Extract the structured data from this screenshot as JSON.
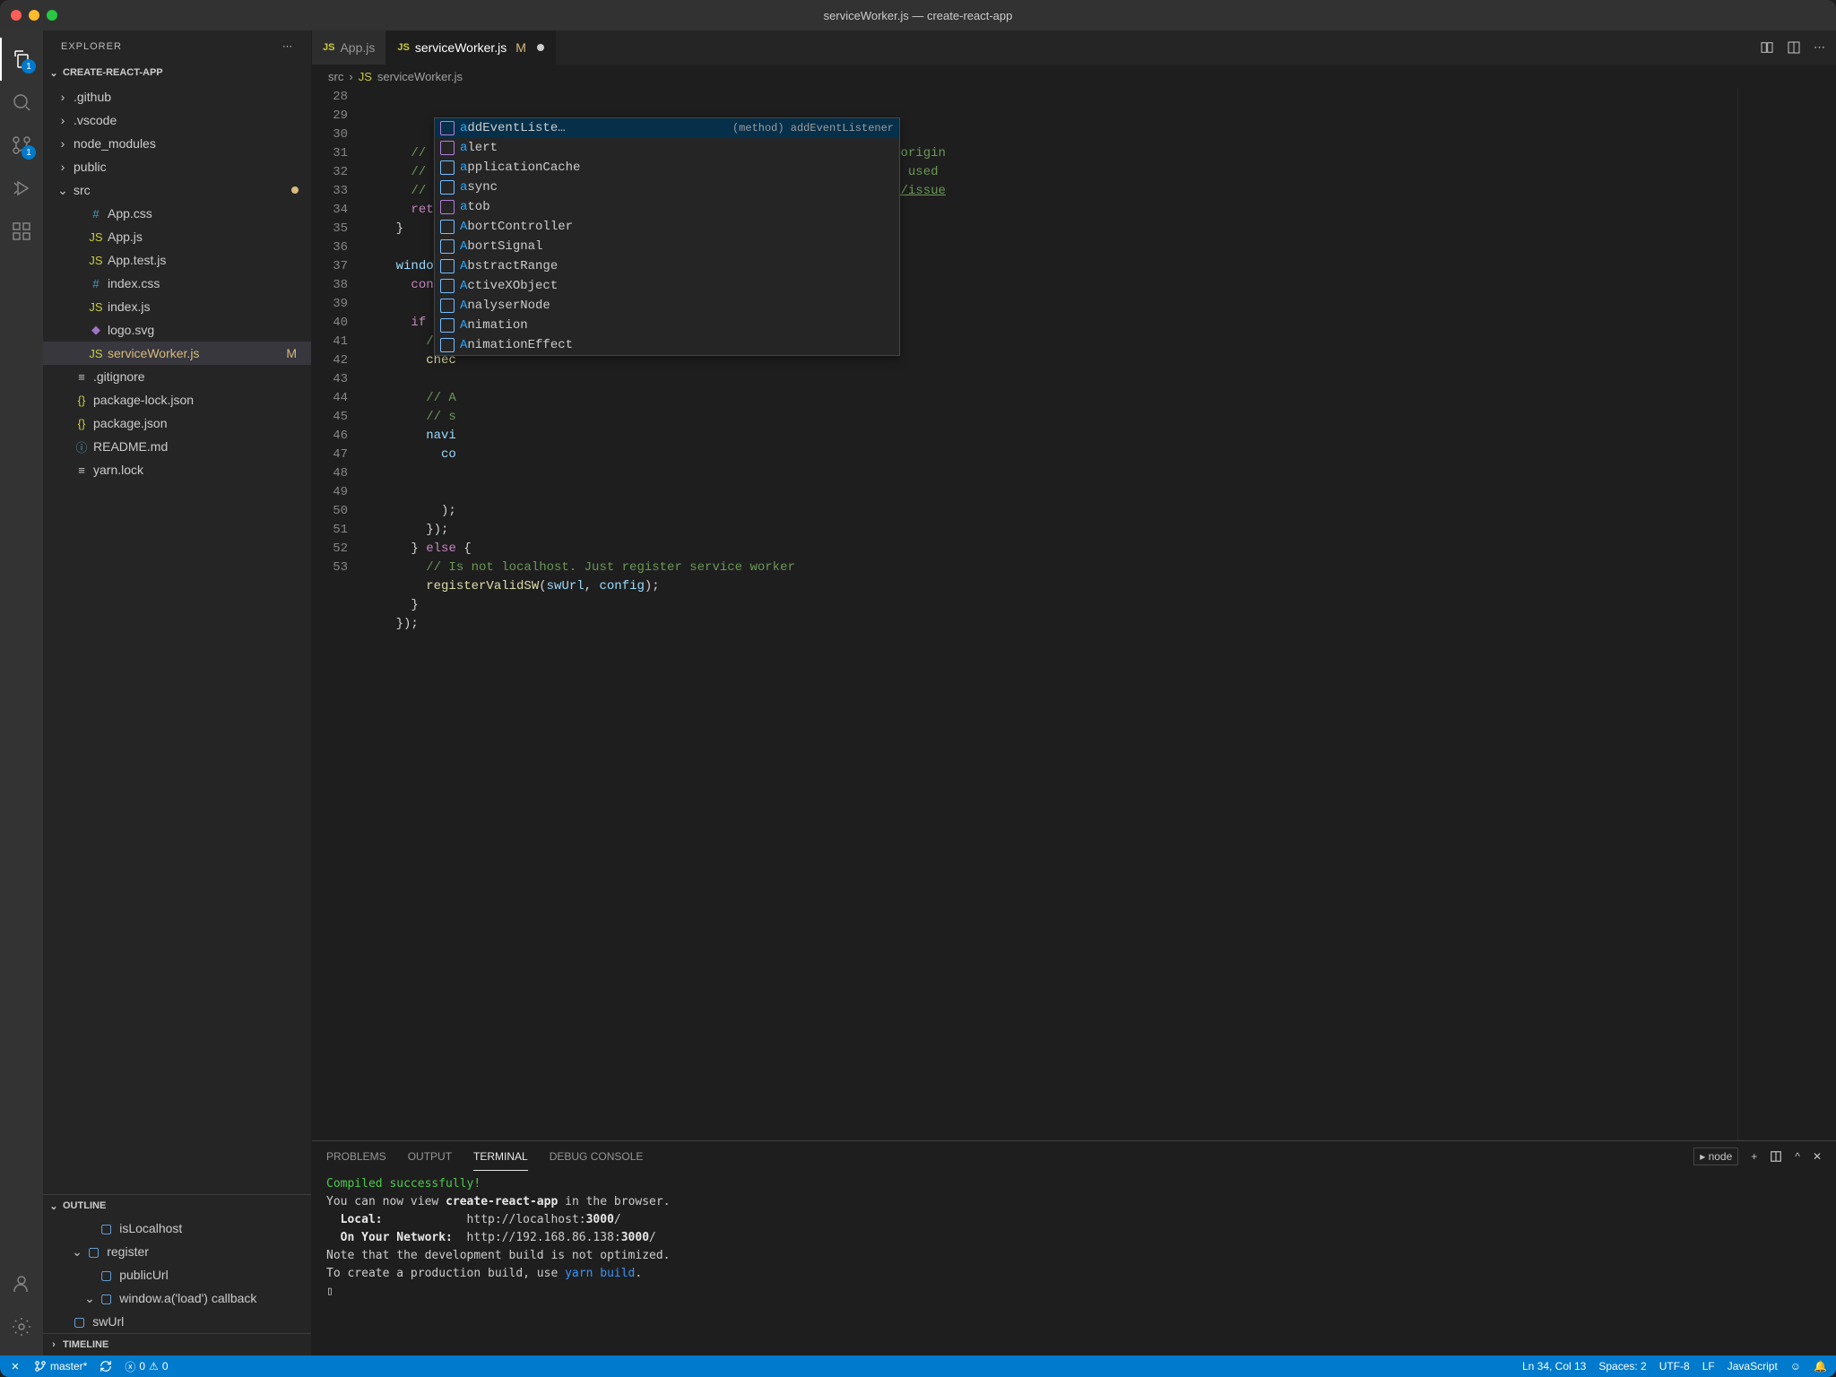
{
  "titlebar": {
    "title": "serviceWorker.js — create-react-app"
  },
  "activity": {
    "explorer_badge": "1",
    "scm_badge": "1"
  },
  "sidebar": {
    "title": "EXPLORER",
    "project": "CREATE-REACT-APP",
    "tree": [
      {
        "name": ".github",
        "type": "folder"
      },
      {
        "name": ".vscode",
        "type": "folder"
      },
      {
        "name": "node_modules",
        "type": "folder"
      },
      {
        "name": "public",
        "type": "folder"
      },
      {
        "name": "src",
        "type": "folder-open"
      },
      {
        "name": "App.css",
        "type": "css",
        "indent": 1
      },
      {
        "name": "App.js",
        "type": "js",
        "indent": 1
      },
      {
        "name": "App.test.js",
        "type": "js",
        "indent": 1
      },
      {
        "name": "index.css",
        "type": "css",
        "indent": 1
      },
      {
        "name": "index.js",
        "type": "js",
        "indent": 1
      },
      {
        "name": "logo.svg",
        "type": "svg",
        "indent": 1
      },
      {
        "name": "serviceWorker.js",
        "type": "js",
        "indent": 1,
        "selected": true,
        "modified": "M"
      },
      {
        "name": ".gitignore",
        "type": "file"
      },
      {
        "name": "package-lock.json",
        "type": "json"
      },
      {
        "name": "package.json",
        "type": "json"
      },
      {
        "name": "README.md",
        "type": "md"
      },
      {
        "name": "yarn.lock",
        "type": "file"
      }
    ],
    "outline_title": "OUTLINE",
    "outline": [
      {
        "name": "isLocalhost",
        "indent": 1
      },
      {
        "name": "register",
        "indent": 0,
        "open": true
      },
      {
        "name": "publicUrl",
        "indent": 1
      },
      {
        "name": "window.a('load') callback",
        "indent": 1,
        "open": true
      },
      {
        "name": "swUrl",
        "indent": 2
      }
    ],
    "timeline_title": "TIMELINE"
  },
  "tabs": [
    {
      "label": "App.js",
      "icon": "JS",
      "active": false
    },
    {
      "label": "serviceWorker.js",
      "icon": "JS",
      "active": true,
      "modified": "M"
    }
  ],
  "breadcrumb": {
    "parts": [
      "src",
      "serviceWorker.js"
    ]
  },
  "editor": {
    "startLine": 28,
    "lines": [
      {
        "n": 28,
        "t": "      // Our service worker won't work if PUBLIC_URL is on a different origin",
        "cls": "c-comment"
      },
      {
        "n": 29,
        "t": "      // from what our page is served on. This might happen if a CDN is used",
        "cls": "c-comment"
      },
      {
        "n": 30,
        "html": "      <span class='c-comment'>// serve assets; see </span><span class='c-link'>https://github.com/facebook/create-react-app/issue</span>"
      },
      {
        "n": 31,
        "html": "      <span class='c-keyword'>return</span><span class='c-punct'>;</span>"
      },
      {
        "n": 32,
        "t": "    }",
        "cls": "c-punct"
      },
      {
        "n": 33,
        "t": ""
      },
      {
        "n": 34,
        "html": "    <span class='c-var'>window</span><span class='c-punct'>.</span><span class='c-func'>a</span><span class='c-punct'>(</span><span class='c-string'>'load'</span><span class='c-punct'>, () </span><span class='c-keyword'>=></span><span class='c-punct'> {</span>"
      },
      {
        "n": 35,
        "html": "      <span class='c-keyword'>const</span>"
      },
      {
        "n": 36,
        "t": ""
      },
      {
        "n": 37,
        "html": "      <span class='c-keyword'>if</span><span class='c-punct'> (is</span>"
      },
      {
        "n": 38,
        "html": "        <span class='c-comment'>// T</span>"
      },
      {
        "n": 39,
        "html": "        <span class='c-func'>chec</span>"
      },
      {
        "n": 40,
        "t": ""
      },
      {
        "n": 41,
        "html": "        <span class='c-comment'>// A</span>"
      },
      {
        "n": 42,
        "html": "        <span class='c-comment'>// s</span>"
      },
      {
        "n": 43,
        "html": "        <span class='c-var'>navi</span>"
      },
      {
        "n": 44,
        "html": "          <span class='c-var'>co</span>"
      },
      {
        "n": 45,
        "t": ""
      },
      {
        "n": 46,
        "t": ""
      },
      {
        "n": 47,
        "t": "          );",
        "cls": "c-punct"
      },
      {
        "n": 48,
        "t": "        });",
        "cls": "c-punct"
      },
      {
        "n": 49,
        "html": "      <span class='c-punct'>} </span><span class='c-keyword'>else</span><span class='c-punct'> {</span>"
      },
      {
        "n": 50,
        "t": "        // Is not localhost. Just register service worker",
        "cls": "c-comment"
      },
      {
        "n": 51,
        "html": "        <span class='c-func'>registerValidSW</span><span class='c-punct'>(</span><span class='c-var'>swUrl</span><span class='c-punct'>, </span><span class='c-var'>config</span><span class='c-punct'>);</span>"
      },
      {
        "n": 52,
        "t": "      }",
        "cls": "c-punct"
      },
      {
        "n": 53,
        "t": "    });",
        "cls": "c-punct"
      }
    ]
  },
  "intellisense": {
    "doc": "(method) addEventListener<K extends k…",
    "items": [
      {
        "label": "addEventListe…",
        "kind": "method",
        "hl": "a",
        "selected": true
      },
      {
        "label": "alert",
        "kind": "method",
        "hl": "a"
      },
      {
        "label": "applicationCache",
        "kind": "var",
        "hl": "a"
      },
      {
        "label": "async",
        "kind": "var",
        "hl": "a"
      },
      {
        "label": "atob",
        "kind": "method",
        "hl": "a"
      },
      {
        "label": "AbortController",
        "kind": "var",
        "hl": "A"
      },
      {
        "label": "AbortSignal",
        "kind": "var",
        "hl": "A"
      },
      {
        "label": "AbstractRange",
        "kind": "var",
        "hl": "A"
      },
      {
        "label": "ActiveXObject",
        "kind": "var",
        "hl": "A"
      },
      {
        "label": "AnalyserNode",
        "kind": "var",
        "hl": "A"
      },
      {
        "label": "Animation",
        "kind": "var",
        "hl": "A"
      },
      {
        "label": "AnimationEffect",
        "kind": "var",
        "hl": "A"
      }
    ]
  },
  "panel": {
    "tabs": [
      "PROBLEMS",
      "OUTPUT",
      "TERMINAL",
      "DEBUG CONSOLE"
    ],
    "active": "TERMINAL",
    "shell": "node",
    "terminal_lines": [
      {
        "t": "Compiled successfully!",
        "cls": "t-green"
      },
      {
        "t": ""
      },
      {
        "html": "You can now view <span class='t-bold'>create-react-app</span> in the browser."
      },
      {
        "t": ""
      },
      {
        "html": "  <span class='t-bold'>Local:</span>            http://localhost:<span class='t-bold'>3000</span>/"
      },
      {
        "html": "  <span class='t-bold'>On Your Network:</span>  http://192.168.86.138:<span class='t-bold'>3000</span>/"
      },
      {
        "t": ""
      },
      {
        "t": "Note that the development build is not optimized."
      },
      {
        "html": "To create a production build, use <span class='t-link'>yarn build</span>."
      },
      {
        "t": ""
      },
      {
        "t": "▯"
      }
    ]
  },
  "statusbar": {
    "branch": "master*",
    "errors": "0",
    "warnings": "0",
    "position": "Ln 34, Col 13",
    "spaces": "Spaces: 2",
    "encoding": "UTF-8",
    "eol": "LF",
    "language": "JavaScript"
  }
}
